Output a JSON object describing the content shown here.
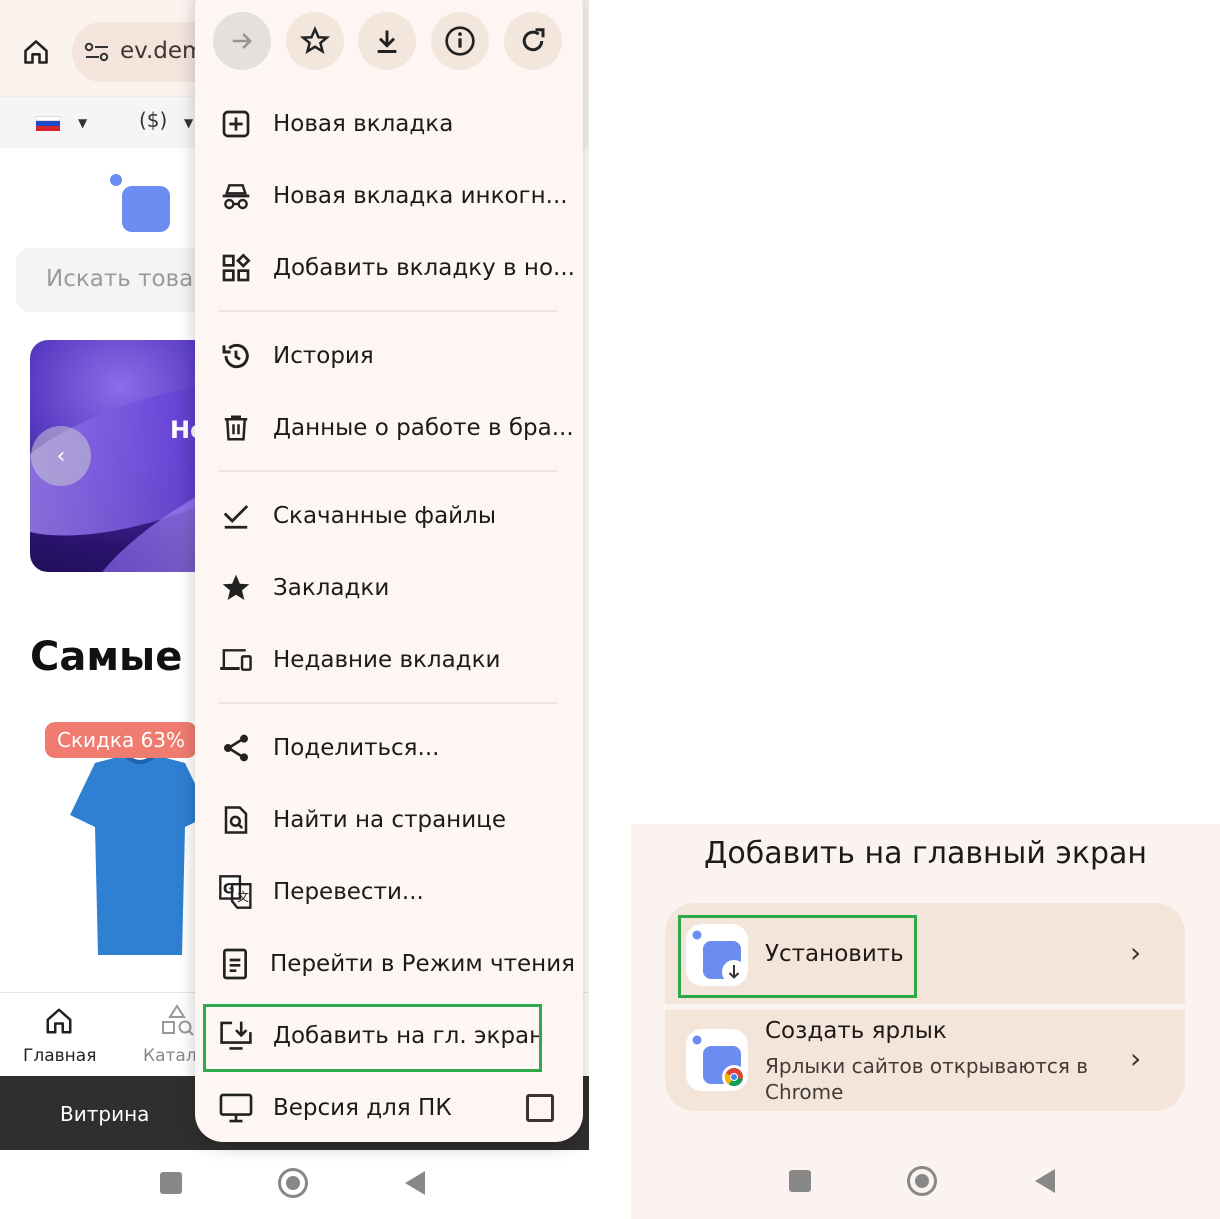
{
  "browser": {
    "url_fragment": "ev.dem",
    "currency": "($)",
    "toolbar": [
      "forward-icon",
      "star-icon",
      "download-icon",
      "info-icon",
      "refresh-icon"
    ]
  },
  "page": {
    "search_placeholder": "Искать товар",
    "banner_text": "Но",
    "section_title": "Самые п",
    "discount_badge": "Скидка 63%",
    "nav_home": "Главная",
    "nav_catalog": "Катало",
    "dark_bar_label": "Витрина"
  },
  "menu": {
    "items": [
      {
        "label": "Новая вкладка",
        "icon": "new-tab-icon"
      },
      {
        "label": "Новая вкладка инкогн...",
        "icon": "incognito-icon"
      },
      {
        "label": "Добавить вкладку в но...",
        "icon": "tab-group-icon"
      },
      {
        "label": "История",
        "icon": "history-icon"
      },
      {
        "label": "Данные  о работе в бра...",
        "icon": "trash-icon"
      },
      {
        "label": "Скачанные файлы",
        "icon": "downloads-icon"
      },
      {
        "label": "Закладки",
        "icon": "bookmark-star-icon"
      },
      {
        "label": "Недавние вкладки",
        "icon": "devices-icon"
      },
      {
        "label": "Поделиться...",
        "icon": "share-icon"
      },
      {
        "label": "Найти на странице",
        "icon": "find-in-page-icon"
      },
      {
        "label": "Перевести...",
        "icon": "translate-icon"
      },
      {
        "label": "Перейти в Режим чтения",
        "icon": "reader-mode-icon"
      },
      {
        "label": "Добавить на гл. экран",
        "icon": "add-to-home-icon"
      },
      {
        "label": "Версия для ПК",
        "icon": "desktop-icon"
      }
    ]
  },
  "sheet": {
    "title": "Добавить на главный экран",
    "install_label": "Установить",
    "shortcut_title": "Создать ярлык",
    "shortcut_subtitle_line1": "Ярлыки сайтов открываются в",
    "shortcut_subtitle_line2": "Chrome"
  },
  "colors": {
    "highlight": "#2ea84a",
    "menu_bg": "#fdf6f2",
    "accent_blue": "#6d8cf2",
    "discount": "#f07b71"
  }
}
